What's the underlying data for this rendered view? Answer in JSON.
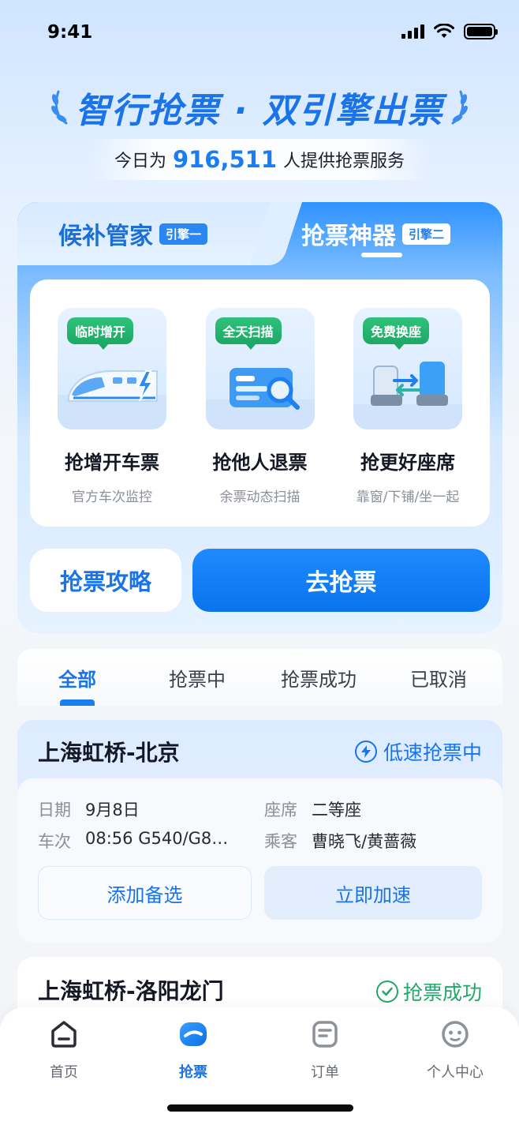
{
  "status_bar": {
    "time": "9:41"
  },
  "hero": {
    "title": "智行抢票 · 双引擎出票",
    "served_prefix": "今日为",
    "served_count": "916,511",
    "served_suffix": "人提供抢票服务"
  },
  "engine_tabs": [
    {
      "label": "候补管家",
      "tag": "引擎一",
      "active": false
    },
    {
      "label": "抢票神器",
      "tag": "引擎二",
      "active": true
    }
  ],
  "features": [
    {
      "badge": "临时增开",
      "title": "抢增开车票",
      "subtitle": "官方车次监控",
      "icon": "train-icon"
    },
    {
      "badge": "全天扫描",
      "title": "抢他人退票",
      "subtitle": "余票动态扫描",
      "icon": "ticket-scan-icon"
    },
    {
      "badge": "免费换座",
      "title": "抢更好座席",
      "subtitle": "靠窗/下铺/坐一起",
      "icon": "seat-swap-icon"
    }
  ],
  "actions": {
    "guide": "抢票攻略",
    "go": "去抢票"
  },
  "filter_tabs": [
    {
      "label": "全部",
      "active": true
    },
    {
      "label": "抢票中",
      "active": false
    },
    {
      "label": "抢票成功",
      "active": false
    },
    {
      "label": "已取消",
      "active": false
    }
  ],
  "orders": [
    {
      "route": "上海虹桥-北京",
      "status": "低速抢票中",
      "date_label": "日期",
      "date": "9月8日",
      "seat_label": "座席",
      "seat": "二等座",
      "train_label": "车次",
      "train": "08:56 G540/G8…",
      "passenger_label": "乘客",
      "passenger": "曹晓飞/黄蔷薇",
      "btn_alt": "添加备选",
      "btn_speed": "立即加速"
    },
    {
      "route": "上海虹桥-洛阳龙门",
      "status": "抢票成功"
    }
  ],
  "bottom_nav": [
    {
      "label": "首页",
      "icon": "home-icon",
      "active": false
    },
    {
      "label": "抢票",
      "icon": "grab-ticket-icon",
      "active": true
    },
    {
      "label": "订单",
      "icon": "order-icon",
      "active": false
    },
    {
      "label": "个人中心",
      "icon": "profile-icon",
      "active": false
    }
  ],
  "colors": {
    "primary": "#1a73e8",
    "success": "#21a86a",
    "badge_green": "#1ca865"
  }
}
